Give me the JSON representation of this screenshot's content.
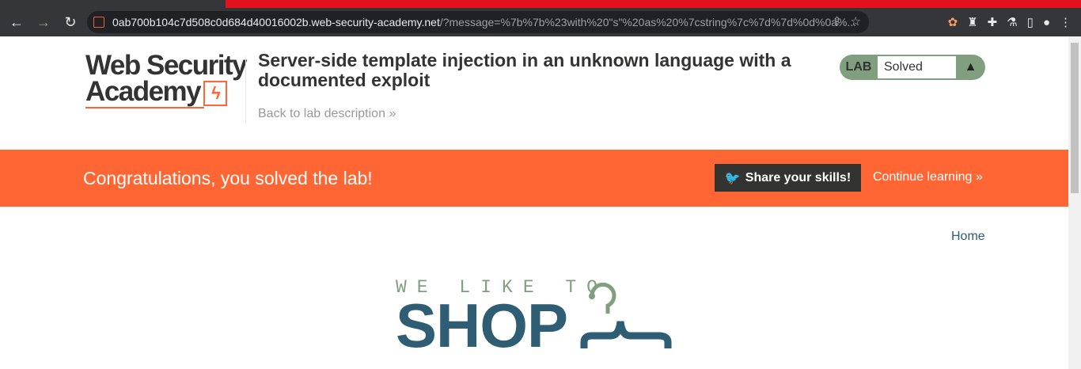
{
  "browser": {
    "url_host": "0ab700b104c7d508c0d684d40016002b.web-security-academy.net",
    "url_path": "/?message=%7b%7b%23with%20\"s\"%20as%20%7cstring%7c%7d%7d%0d%0a%..."
  },
  "logo": {
    "line1": "Web Security",
    "line2": "Academy"
  },
  "header": {
    "title": "Server-side template injection in an unknown language with a documented exploit",
    "back_link": "Back to lab description",
    "chevrons": "»"
  },
  "lab_badge": {
    "label": "LAB",
    "status": "Solved"
  },
  "banner": {
    "message": "Congratulations, you solved the lab!",
    "share_label": "Share your skills!",
    "continue_label": "Continue learning"
  },
  "nav": {
    "home": "Home"
  },
  "shop_logo": {
    "top": "WE LIKE TO",
    "main": "SHOP"
  },
  "colors": {
    "accent": "#ff6633",
    "green": "#7f9f7f",
    "blue": "#2e5d74"
  }
}
